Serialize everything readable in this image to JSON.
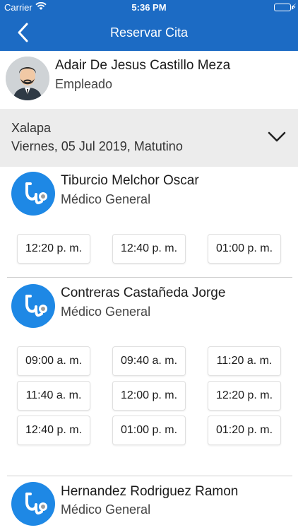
{
  "status_bar": {
    "carrier": "Carrier",
    "time": "5:36 PM"
  },
  "nav": {
    "title": "Reservar Cita"
  },
  "user": {
    "name": "Adair De Jesus Castillo Meza",
    "role": "Empleado"
  },
  "appointment_selector": {
    "city": "Xalapa",
    "date_shift": "Viernes, 05 Jul 2019, Matutino"
  },
  "doctors": [
    {
      "name": "Tiburcio Melchor Oscar",
      "specialty": "Médico General",
      "slots": [
        "12:20 p. m.",
        "12:40 p. m.",
        "01:00 p. m."
      ]
    },
    {
      "name": "Contreras Castañeda Jorge",
      "specialty": "Médico General",
      "slots": [
        "09:00 a. m.",
        "09:40 a. m.",
        "11:20 a. m.",
        "11:40 a. m.",
        "12:00 p. m.",
        "12:20 p. m.",
        "12:40 p. m.",
        "01:00 p. m.",
        "01:20 p. m."
      ]
    },
    {
      "name": "Hernandez Rodriguez Ramon",
      "specialty": "Médico General",
      "slots": []
    }
  ],
  "colors": {
    "header": "#1c6bc4",
    "doctor_icon": "#1e88e5",
    "selector_bg": "#ececec",
    "battery": "#4cd964"
  },
  "icons": {
    "back": "chevron-left-icon",
    "expand": "chevron-down-icon",
    "doctor": "stethoscope-icon",
    "avatar": "user-avatar",
    "wifi": "wifi-icon",
    "battery": "battery-icon"
  }
}
